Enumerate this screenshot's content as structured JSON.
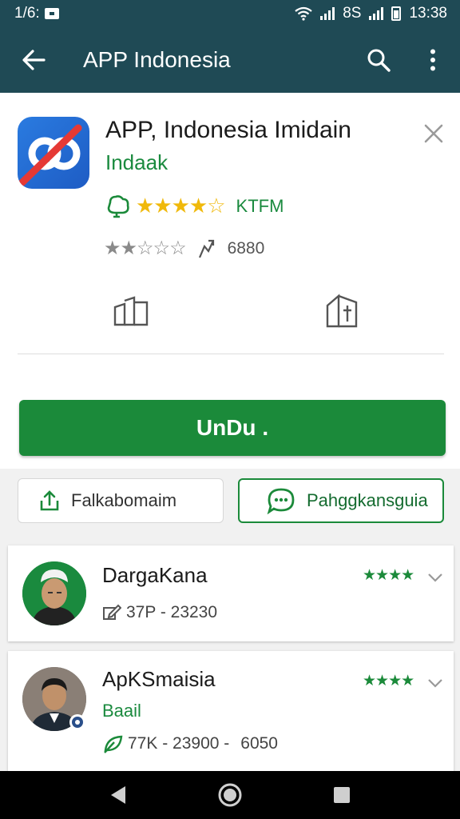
{
  "status_bar": {
    "time_left": "1/6:",
    "time_right": "13:38",
    "carrier": "8S"
  },
  "app_bar": {
    "title": "APP Indonesia"
  },
  "app": {
    "title": "APP, Indonesia Imidain",
    "developer": "Indaak",
    "rating_stars": "★★★★☆",
    "rating_value": 3.5,
    "rating_code": "KTFM",
    "review_stars": "★★☆☆☆",
    "review_value": 2,
    "downloads": "6880"
  },
  "install_label": "UnDu .",
  "share_label": "Falkabomaim",
  "chat_label": "Pahggkansguia",
  "users": [
    {
      "name": "DargaKana",
      "meta": "37P - 23230",
      "stars": "★★★★",
      "rating": 4
    },
    {
      "name": "ApKSmaisia",
      "sub": "Baail",
      "meta": "77K - 23900 -",
      "meta_extra": "6050",
      "stars": "★★★★",
      "rating": 4
    }
  ],
  "colors": {
    "primary": "#1f4a55",
    "accent": "#1b8a3a",
    "star": "#f0b90b"
  }
}
